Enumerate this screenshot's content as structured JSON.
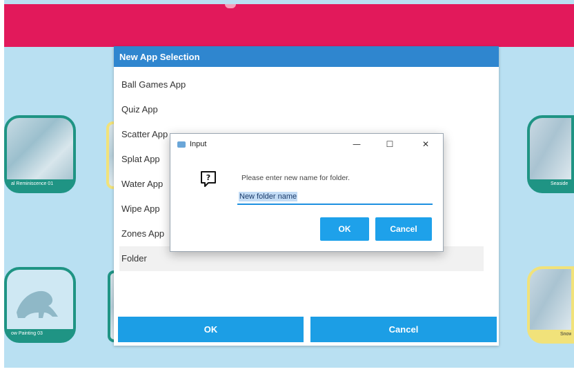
{
  "background": {
    "tiles": [
      {
        "caption": "al Reminiscence 01"
      },
      {
        "caption": "ow Painting 03"
      },
      {
        "caption": "Seaside"
      },
      {
        "caption": "Snow"
      }
    ]
  },
  "app_dialog": {
    "title": "New App Selection",
    "items": [
      {
        "label": "Ball Games App"
      },
      {
        "label": "Quiz App"
      },
      {
        "label": "Scatter App"
      },
      {
        "label": "Splat App"
      },
      {
        "label": "Water App"
      },
      {
        "label": "Wipe App"
      },
      {
        "label": "Zones App"
      },
      {
        "label": "Folder"
      }
    ],
    "selected_item": "Folder",
    "ok_label": "OK",
    "cancel_label": "Cancel"
  },
  "input_dialog": {
    "title": "Input",
    "minimize_glyph": "—",
    "maximize_glyph": "☐",
    "close_glyph": "✕",
    "prompt": "Please enter new name for folder.",
    "value": "New folder name",
    "ok_label": "OK",
    "cancel_label": "Cancel",
    "icon": "question-icon"
  },
  "colors": {
    "top_bar": "#e2195b",
    "app_background": "#b9e0f2",
    "dialog_title": "#2f86cf",
    "button": "#1c9ee5"
  }
}
